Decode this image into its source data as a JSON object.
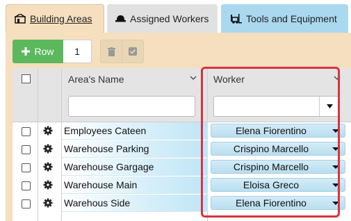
{
  "tabs": [
    {
      "label": "Building Areas",
      "icon": "building-icon"
    },
    {
      "label": "Assigned Workers",
      "icon": "hardhat-icon"
    },
    {
      "label": "Tools and Equipment",
      "icon": "forklift-icon"
    }
  ],
  "toolbar": {
    "add_row_label": "Row",
    "row_count": "1",
    "delete_icon": "trash-icon",
    "confirm_icon": "check-icon"
  },
  "grid": {
    "columns": {
      "area_name": "Area's Name",
      "worker": "Worker"
    },
    "filters": {
      "area_name_value": "",
      "worker_value": ""
    },
    "rows": [
      {
        "area": "Employees Cateen",
        "worker": "Elena Fiorentino"
      },
      {
        "area": "Warehouse Parking",
        "worker": "Crispino Marcello"
      },
      {
        "area": "Warehouse Gargage",
        "worker": "Crispino Marcello"
      },
      {
        "area": "Warehouse Main",
        "worker": "Eloisa Greco"
      },
      {
        "area": "Warehous Side",
        "worker": "Elena Fiorentino"
      }
    ]
  },
  "colors": {
    "tab_active": "#f5dfbf",
    "tab_workers": "#e1e1e1",
    "tab_tools": "#a9d8ef",
    "add_button": "#5cb85c",
    "highlight": "#d9323f"
  }
}
